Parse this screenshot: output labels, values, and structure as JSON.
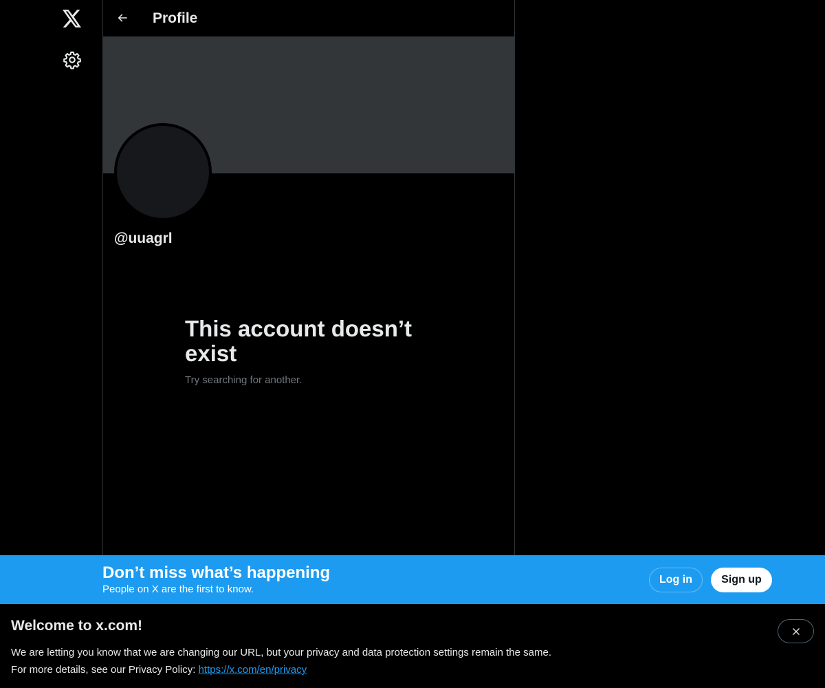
{
  "nav": {
    "logo_icon": "x-logo-icon",
    "settings_icon": "gear-icon"
  },
  "header": {
    "back_icon": "arrow-left-icon",
    "title": "Profile"
  },
  "profile": {
    "handle": "@uuagrl",
    "empty_title": "This account doesn’t exist",
    "empty_subtitle": "Try searching for another."
  },
  "signup_bar": {
    "title": "Don’t miss what’s happening",
    "subtitle": "People on X are the first to know.",
    "login_label": "Log in",
    "signup_label": "Sign up",
    "background_color": "#1d9bf0"
  },
  "welcome": {
    "title": "Welcome to x.com!",
    "line1": "We are letting you know that we are changing our URL, but your privacy and data protection settings remain the same.",
    "line2_prefix": "For more details, see our Privacy Policy: ",
    "privacy_link": "https://x.com/en/privacy",
    "close_icon": "close-icon"
  }
}
